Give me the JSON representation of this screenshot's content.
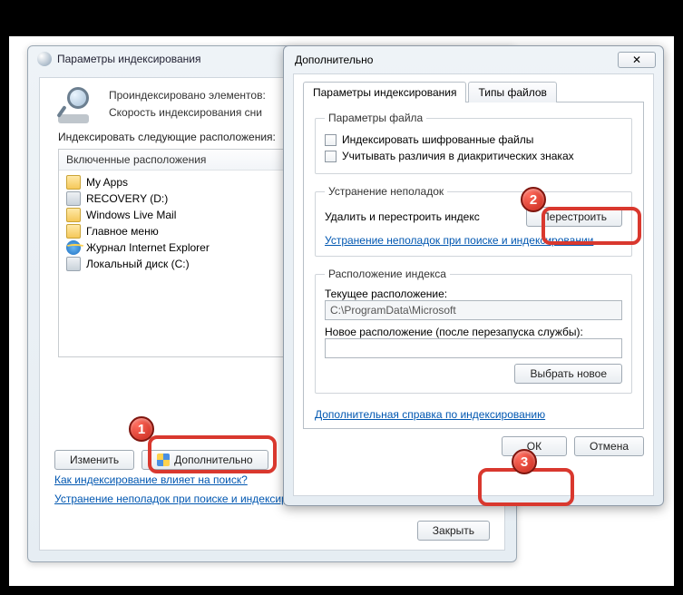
{
  "back": {
    "title": "Параметры индексирования",
    "info1": "Проиндексировано элементов:",
    "info2": "Скорость индексирования сни",
    "section": "Индексировать следующие расположения:",
    "list_header": "Включенные расположения",
    "items": [
      {
        "label": "My Apps",
        "icon": "folder"
      },
      {
        "label": "RECOVERY (D:)",
        "icon": "drive"
      },
      {
        "label": "Windows Live Mail",
        "icon": "folder"
      },
      {
        "label": "Главное меню",
        "icon": "folder"
      },
      {
        "label": "Журнал Internet Explorer",
        "icon": "ie"
      },
      {
        "label": "Локальный диск (C:)",
        "icon": "drive"
      }
    ],
    "btn_modify": "Изменить",
    "btn_advanced": "Дополнительно",
    "link1": "Как индексирование влияет на поиск?",
    "link2": "Устранение неполадок при поиске и индексировании",
    "btn_close": "Закрыть"
  },
  "front": {
    "title": "Дополнительно",
    "tab1": "Параметры индексирования",
    "tab2": "Типы файлов",
    "fs_file": {
      "legend": "Параметры файла",
      "chk1": "Индексировать шифрованные файлы",
      "chk2": "Учитывать различия в диакритических знаках"
    },
    "fs_trouble": {
      "legend": "Устранение неполадок",
      "row_label": "Удалить и перестроить индекс",
      "btn_rebuild": "Перестроить",
      "link": "Устранение неполадок при поиске и индексировании"
    },
    "fs_loc": {
      "legend": "Расположение индекса",
      "current_lbl": "Текущее расположение:",
      "current_val": "C:\\ProgramData\\Microsoft",
      "new_lbl": "Новое расположение (после перезапуска службы):",
      "new_val": "",
      "btn_new": "Выбрать новое"
    },
    "help": "Дополнительная справка по индексированию",
    "btn_ok": "ОК",
    "btn_cancel": "Отмена"
  },
  "annot": {
    "b1": "1",
    "b2": "2",
    "b3": "3"
  }
}
